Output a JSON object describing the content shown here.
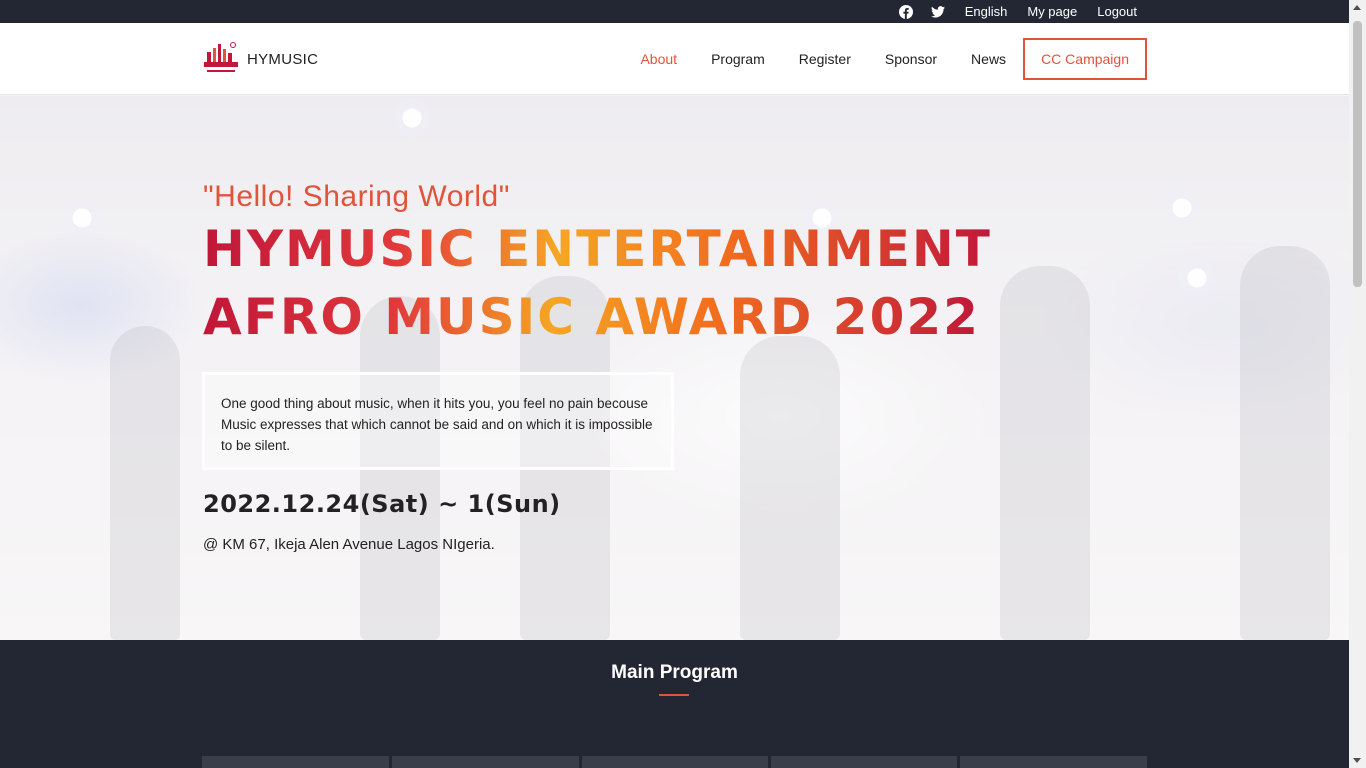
{
  "topbar": {
    "icons": [
      "facebook-icon",
      "twitter-icon"
    ],
    "language": "English",
    "mypage": "My page",
    "logout": "Logout"
  },
  "brand": {
    "name": "HYMUSIC"
  },
  "nav": {
    "items": [
      "About",
      "Program",
      "Register",
      "Sponsor",
      "News"
    ],
    "cta": "CC Campaign",
    "active": "About"
  },
  "hero": {
    "tagline": "\"Hello! Sharing World\"",
    "title_line1": "HYMUSIC ENTERTAINMENT",
    "title_line2": "AFRO MUSIC AWARD 2022",
    "quote": "One good thing about music, when it hits you, you feel no pain becouse Music expresses that which cannot be said and on which it is impossible to be silent.",
    "date": "2022.12.24(Sat) ~ 1(Sun)",
    "venue": "@ KM 67, Ikeja Alen Avenue Lagos NIgeria."
  },
  "program": {
    "heading": "Main Program"
  },
  "colors": {
    "accent": "#e0543c",
    "dark": "#232733"
  }
}
